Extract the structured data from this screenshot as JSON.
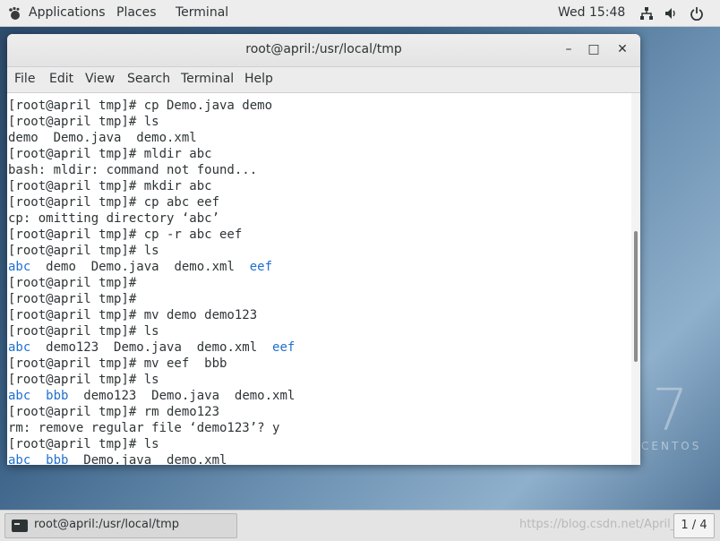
{
  "top_bar": {
    "applications": "Applications",
    "places": "Places",
    "terminal": "Terminal",
    "clock": "Wed 15:48",
    "icons": [
      "network-icon",
      "volume-icon",
      "power-icon"
    ]
  },
  "desktop": {
    "logo_number": "7",
    "logo_text": "CENTOS"
  },
  "window": {
    "title": "root@april:/usr/local/tmp",
    "minimize": "–",
    "maximize": "□",
    "close": "✕"
  },
  "menu": [
    "File",
    "Edit",
    "View",
    "Search",
    "Terminal",
    "Help"
  ],
  "terminal": {
    "lines": [
      [
        {
          "t": "[root@april tmp]# cp Demo.java demo"
        }
      ],
      [
        {
          "t": "[root@april tmp]# ls"
        }
      ],
      [
        {
          "t": "demo  Demo.java  demo.xml"
        }
      ],
      [
        {
          "t": "[root@april tmp]# mldir abc"
        }
      ],
      [
        {
          "t": "bash: mldir: command not found..."
        }
      ],
      [
        {
          "t": "[root@april tmp]# mkdir abc"
        }
      ],
      [
        {
          "t": "[root@april tmp]# cp abc eef"
        }
      ],
      [
        {
          "t": "cp: omitting directory ‘abc’"
        }
      ],
      [
        {
          "t": "[root@april tmp]# cp -r abc eef"
        }
      ],
      [
        {
          "t": "[root@april tmp]# ls"
        }
      ],
      [
        {
          "t": "abc",
          "dir": true
        },
        {
          "t": "  demo  Demo.java  demo.xml  "
        },
        {
          "t": "eef",
          "dir": true
        }
      ],
      [
        {
          "t": "[root@april tmp]#"
        }
      ],
      [
        {
          "t": "[root@april tmp]#"
        }
      ],
      [
        {
          "t": "[root@april tmp]# mv demo demo123"
        }
      ],
      [
        {
          "t": "[root@april tmp]# ls"
        }
      ],
      [
        {
          "t": "abc",
          "dir": true
        },
        {
          "t": "  demo123  Demo.java  demo.xml  "
        },
        {
          "t": "eef",
          "dir": true
        }
      ],
      [
        {
          "t": "[root@april tmp]# mv eef  bbb"
        }
      ],
      [
        {
          "t": "[root@april tmp]# ls"
        }
      ],
      [
        {
          "t": "abc",
          "dir": true
        },
        {
          "t": "  "
        },
        {
          "t": "bbb",
          "dir": true
        },
        {
          "t": "  demo123  Demo.java  demo.xml"
        }
      ],
      [
        {
          "t": "[root@april tmp]# rm demo123"
        }
      ],
      [
        {
          "t": "rm: remove regular file ‘demo123’? y"
        }
      ],
      [
        {
          "t": "[root@april tmp]# ls"
        }
      ],
      [
        {
          "t": "abc",
          "dir": true
        },
        {
          "t": "  "
        },
        {
          "t": "bbb",
          "dir": true
        },
        {
          "t": "  Demo.java  demo.xml"
        }
      ]
    ]
  },
  "taskbar": {
    "task_label": "root@april:/usr/local/tmp",
    "watermark": "https://blog.csdn.net/April_???",
    "workspace": "1 / 4"
  },
  "colors": {
    "directory": "#1f6fd0",
    "text": "#2e3436"
  }
}
